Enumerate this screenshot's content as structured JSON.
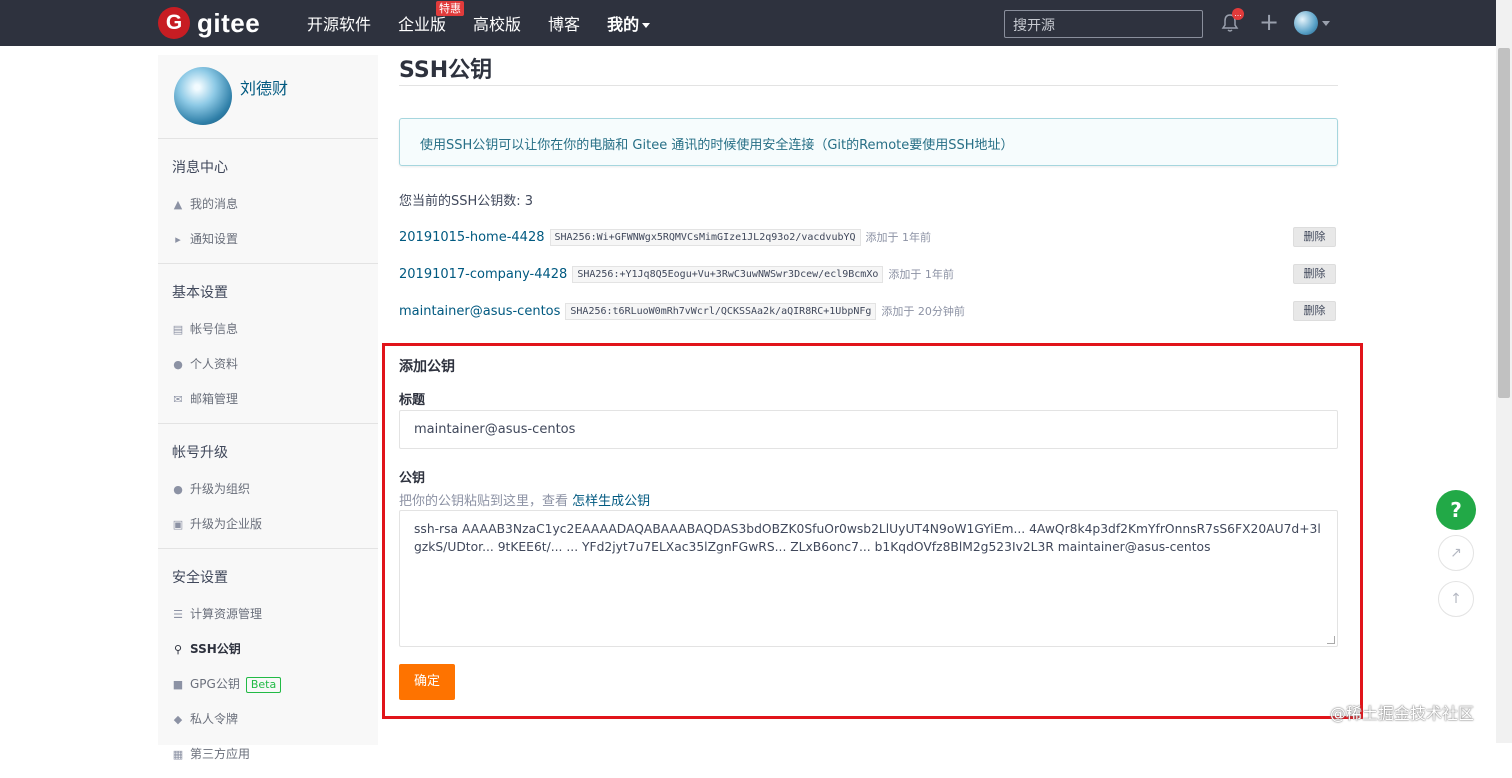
{
  "nav": {
    "logo_mark": "G",
    "logo_text": "gitee",
    "items": [
      "开源软件",
      "企业版",
      "高校版",
      "博客",
      "我的"
    ],
    "enterprise_badge": "特惠",
    "search_placeholder": "搜开源",
    "bell_badge": "...",
    "plus_symbol": "+"
  },
  "sidebar": {
    "username": "刘德财",
    "sections": [
      {
        "title": "消息中心",
        "items": [
          {
            "label": "我的消息",
            "icon": "bell-icon"
          },
          {
            "label": "通知设置",
            "icon": "volume-icon"
          }
        ]
      },
      {
        "title": "基本设置",
        "items": [
          {
            "label": "帐号信息",
            "icon": "id-card-icon"
          },
          {
            "label": "个人资料",
            "icon": "user-icon"
          },
          {
            "label": "邮箱管理",
            "icon": "mail-icon"
          }
        ]
      },
      {
        "title": "帐号升级",
        "items": [
          {
            "label": "升级为组织",
            "icon": "group-icon"
          },
          {
            "label": "升级为企业版",
            "icon": "building-icon"
          }
        ]
      },
      {
        "title": "安全设置",
        "items": [
          {
            "label": "计算资源管理",
            "icon": "list-icon"
          },
          {
            "label": "SSH公钥",
            "icon": "key-icon"
          },
          {
            "label": "GPG公钥",
            "icon": "lock-icon",
            "badge": "Beta"
          },
          {
            "label": "私人令牌",
            "icon": "token-icon"
          },
          {
            "label": "第三方应用",
            "icon": "app-icon"
          }
        ]
      }
    ]
  },
  "main": {
    "title": "SSH公钥",
    "info": "使用SSH公钥可以让你在你的电脑和 Gitee 通讯的时候使用安全连接（Git的Remote要使用SSH地址）",
    "count_label": "您当前的SSH公钥数: 3",
    "keys": [
      {
        "name": "20191015-home-4428",
        "fingerprint": "SHA256:Wi+GFWNWgx5RQMVCsMimGIze1JL2q93o2/vacdvubYQ",
        "added": "添加于 1年前",
        "delete": "删除"
      },
      {
        "name": "20191017-company-4428",
        "fingerprint": "SHA256:+Y1Jq8Q5Eogu+Vu+3RwC3uwNWSwr3Dcew/ecl9BcmXo",
        "added": "添加于 1年前",
        "delete": "删除"
      },
      {
        "name": "maintainer@asus-centos",
        "fingerprint": "SHA256:t6RLuoW0mRh7vWcrl/QCKSSAa2k/aQIR8RC+1UbpNFg",
        "added": "添加于 20分钟前",
        "delete": "删除"
      }
    ],
    "add_section": {
      "heading": "添加公钥",
      "title_label": "标题",
      "title_value": "maintainer@asus-centos",
      "key_label": "公钥",
      "hint_prefix": "把你的公钥粘贴到这里，查看",
      "hint_link": "怎样生成公钥",
      "key_value": "ssh-rsa AAAAB3NzaC1yc2EAAAADAQABAAABAQDAS3bdOBZK0SfuOr0wsb2LlUyUT4N9oW1GYiEm... 4AwQr8k4p3df2KmYfrOnnsR7sS6FX20AU7d+3lgzkS/UDtor... 9tKEE6t/... ... YFd2jyt7u7ELXac35lZgnFGwRS... ZLxB6onc7... b1KqdOVfz8BlM2g523Iv2L3R maintainer@asus-centos",
      "submit": "确定"
    }
  },
  "floating": {
    "help": "?",
    "share_icon": "share-icon",
    "top_icon": "arrow-up-icon"
  },
  "watermark": "@稀土掘金技术社区"
}
